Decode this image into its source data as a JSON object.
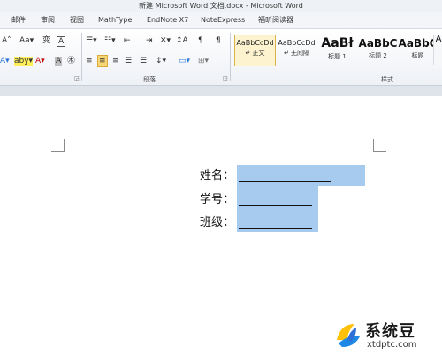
{
  "window": {
    "title": "新建 Microsoft Word 文档.docx - Microsoft Word"
  },
  "menu": [
    "邮件",
    "审阅",
    "视图",
    "MathType",
    "EndNote X7",
    "NoteExpress",
    "福昕阅读器"
  ],
  "ribbon": {
    "groups": {
      "paragraph": "段落",
      "styles": "样式"
    },
    "styles": [
      {
        "sample": "AaBbCcDd",
        "name": "正文",
        "active": true
      },
      {
        "sample": "AaBbCcDd",
        "name": "无间隔",
        "active": false
      },
      {
        "sample": "AaBł",
        "name": "标题 1",
        "active": false
      },
      {
        "sample": "AaBbC",
        "name": "标题 2",
        "active": false
      },
      {
        "sample": "AaBbC",
        "name": "标题",
        "active": false
      },
      {
        "sample": "A",
        "name": "",
        "active": false
      }
    ],
    "icons": {
      "row1": [
        "A˄",
        "Aa▾",
        "变",
        "A",
        "☰▾",
        "☷▾",
        "⇤",
        "⇥",
        "✕▾",
        "↕A",
        "¶"
      ],
      "row2": [
        "A▾",
        "aby▾",
        "A▾",
        "A",
        "㊍",
        "≡",
        "≡",
        "≡",
        "☰",
        "↕▾",
        "▭▾",
        "⊞▾"
      ]
    }
  },
  "document": {
    "fields": [
      {
        "label": "姓名："
      },
      {
        "label": "学号："
      },
      {
        "label": "班级："
      }
    ]
  },
  "watermark": {
    "text": "系统豆",
    "url": "xtdptc.com"
  },
  "colors": {
    "highlight": "#a7caef",
    "accent": "#2b579a",
    "wm_blue": "#1e88e5",
    "wm_yellow": "#ffc107"
  }
}
